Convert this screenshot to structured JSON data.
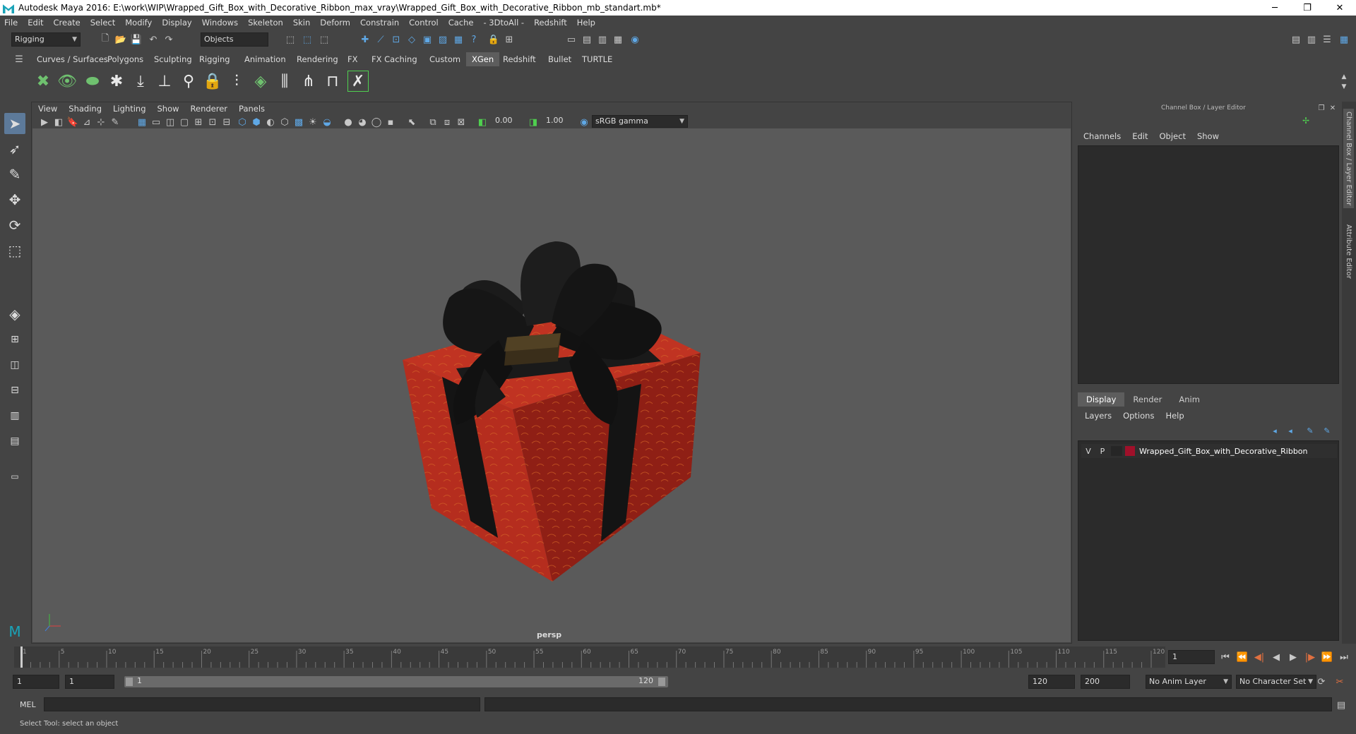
{
  "title": {
    "text": "Autodesk Maya 2016: E:\\work\\WIP\\Wrapped_Gift_Box_with_Decorative_Ribbon_max_vray\\Wrapped_Gift_Box_with_Decorative_Ribbon_mb_standart.mb*",
    "minimize": "─",
    "restore": "❐",
    "close": "✕"
  },
  "menubar": [
    "File",
    "Edit",
    "Create",
    "Select",
    "Modify",
    "Display",
    "Windows",
    "Skeleton",
    "Skin",
    "Deform",
    "Constrain",
    "Control",
    "Cache",
    "- 3DtoAll -",
    "Redshift",
    "Help"
  ],
  "status": {
    "mode_dropdown": "Rigging",
    "selection_dropdown": "Objects"
  },
  "shelf_tabs": [
    {
      "label": "Curves / Surfaces",
      "active": false
    },
    {
      "label": "Polygons",
      "active": false
    },
    {
      "label": "Sculpting",
      "active": false
    },
    {
      "label": "Rigging",
      "active": false
    },
    {
      "label": "Animation",
      "active": false
    },
    {
      "label": "Rendering",
      "active": false
    },
    {
      "label": "FX",
      "active": false
    },
    {
      "label": "FX Caching",
      "active": false
    },
    {
      "label": "Custom",
      "active": false
    },
    {
      "label": "XGen",
      "active": true
    },
    {
      "label": "Redshift",
      "active": false
    },
    {
      "label": "Bullet",
      "active": false
    },
    {
      "label": "TURTLE",
      "active": false
    }
  ],
  "viewport": {
    "menu": [
      "View",
      "Shading",
      "Lighting",
      "Show",
      "Renderer",
      "Panels"
    ],
    "exposure": "0.00",
    "gamma": "1.00",
    "colorspace": "sRGB gamma",
    "camera_label": "persp",
    "colors": {
      "background": "#5a5a5a",
      "box_front": "#b52d1e",
      "box_side": "#8f1f15",
      "box_top": "#c03322",
      "ribbon": "#141414"
    }
  },
  "channel_box": {
    "header": "Channel Box / Layer Editor",
    "menu": [
      "Channels",
      "Edit",
      "Object",
      "Show"
    ]
  },
  "layer_editor": {
    "tabs": [
      {
        "label": "Display",
        "active": true
      },
      {
        "label": "Render",
        "active": false
      },
      {
        "label": "Anim",
        "active": false
      }
    ],
    "menu": [
      "Layers",
      "Options",
      "Help"
    ],
    "layer": {
      "v": "V",
      "p": "P",
      "name": "Wrapped_Gift_Box_with_Decorative_Ribbon",
      "color": "#a0102a"
    }
  },
  "side_tabs": [
    "Channel Box / Layer Editor",
    "Attribute Editor"
  ],
  "timeline": {
    "ticks": [
      "1",
      "5",
      "10",
      "15",
      "20",
      "25",
      "30",
      "35",
      "40",
      "45",
      "50",
      "55",
      "60",
      "65",
      "70",
      "75",
      "80",
      "85",
      "90",
      "95",
      "100",
      "105",
      "110",
      "115",
      "120"
    ],
    "current_frame": "1"
  },
  "range": {
    "start": "1",
    "playback_start": "1",
    "slider_start": "1",
    "slider_end": "120",
    "playback_end": "120",
    "end": "200",
    "anim_layer": "No Anim Layer",
    "char_set": "No Character Set"
  },
  "command": {
    "label": "MEL"
  },
  "helpline": {
    "text": "Select Tool: select an object"
  }
}
